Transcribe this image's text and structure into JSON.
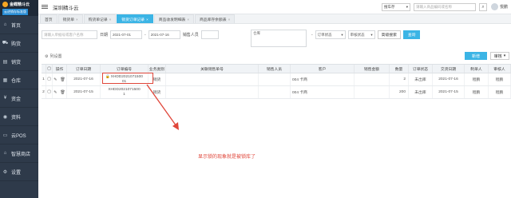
{
  "brand": {
    "name": "金蝶精斗云",
    "tagline": "云进销存标准版"
  },
  "sidebar": {
    "items": [
      {
        "label": "首页",
        "icon": "home-icon"
      },
      {
        "label": "购货",
        "icon": "cart-icon"
      },
      {
        "label": "销货",
        "icon": "sales-icon"
      },
      {
        "label": "仓库",
        "icon": "warehouse-icon"
      },
      {
        "label": "资金",
        "icon": "money-icon"
      },
      {
        "label": "资料",
        "icon": "data-icon"
      },
      {
        "label": "云POS",
        "icon": "pos-icon"
      },
      {
        "label": "智慧商店",
        "icon": "store-icon"
      },
      {
        "label": "设置",
        "icon": "gear-icon"
      }
    ]
  },
  "header": {
    "app_title": "深圳精斗云",
    "search_type": "搜车存",
    "search_placeholder": "请输入商品编码或名称",
    "user_name": "悦鹏"
  },
  "tabs": [
    {
      "label": "首页",
      "closable": false,
      "active": false
    },
    {
      "label": "销货单",
      "closable": true,
      "active": false
    },
    {
      "label": "购货单记录",
      "closable": true,
      "active": false
    },
    {
      "label": "销货订单记录",
      "closable": true,
      "active": true
    },
    {
      "label": "商品收发明细表",
      "closable": true,
      "active": false
    },
    {
      "label": "商品库存余额表",
      "closable": true,
      "active": false
    }
  ],
  "filters": {
    "keyword_placeholder": "请输入单据号或客户名称",
    "date_label": "日期",
    "date_from": "2021-07-01",
    "date_to": "2021-07-16",
    "sales_person_label": "销售人员",
    "warehouse_label": "仓库",
    "order_status_label": "订单状态",
    "audit_status_label": "审核状态",
    "advanced_search_label": "高级搜索",
    "query_label": "查询"
  },
  "toolbar": {
    "column_settings_label": "列设置",
    "new_label": "新增",
    "audit_label": "审核"
  },
  "table": {
    "columns": [
      "操作",
      "订单日期",
      "订单编号",
      "业务类别",
      "关联销售单号",
      "销售人员",
      "客户",
      "销售金额",
      "数量",
      "订单状态",
      "交货日期",
      "制单人",
      "审核人"
    ],
    "rows": [
      {
        "date": "2021-07-16",
        "order_no": "XHDD2021071500",
        "order_no_suffix": "01",
        "category": "销货",
        "linked_sales_no": "",
        "sales_person": "",
        "customer": "004 卡商",
        "amount": "",
        "quantity": "2",
        "status": "未出库",
        "delivery_date": "2021-07-16",
        "creator": "程鹏",
        "auditor": "程鹏"
      },
      {
        "date": "2021-07-15",
        "order_no": "XHDD2021071500",
        "order_no_suffix": "1",
        "category": "销货",
        "linked_sales_no": "",
        "sales_person": "",
        "customer": "004 卡商",
        "amount": "",
        "quantity": "200",
        "status": "未出库",
        "delivery_date": "2021-07-15",
        "creator": "程鹏",
        "auditor": "程鹏"
      }
    ]
  },
  "annotation": {
    "text": "显示锁的现象就是被锁库了"
  },
  "colors": {
    "accent": "#3bb4e5",
    "sidebar": "#2e3a4a",
    "annotation": "#e0463a"
  }
}
